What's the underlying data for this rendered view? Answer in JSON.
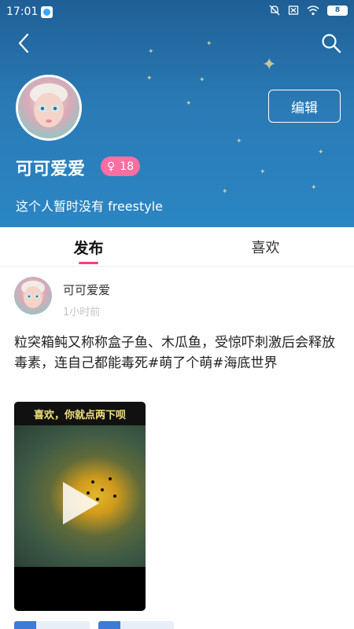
{
  "status_bar": {
    "time": "17:01",
    "battery": "8"
  },
  "header": {
    "edit_label": "编辑",
    "username": "可可爱爱",
    "gender_symbol": "♀",
    "age": "18",
    "bio": "这个人暂时没有 freestyle",
    "colors": {
      "background": "#2a7ab5",
      "badge": "#ff6ea0"
    }
  },
  "tabs": [
    {
      "label": "发布",
      "active": true
    },
    {
      "label": "喜欢",
      "active": false
    }
  ],
  "post": {
    "author": "可可爱爱",
    "time": "1小时前",
    "text": "粒突箱鲀又称称盒子鱼、木瓜鱼，受惊吓刺激后会释放毒素，连自己都能毒死#萌了个萌#海底世界",
    "video": {
      "banner": "喜欢，你就点两下呗",
      "icon": "play-icon"
    }
  },
  "icons": [
    "back-arrow-icon",
    "search-icon",
    "mute-icon",
    "sim-icon",
    "wifi-icon",
    "battery-icon"
  ]
}
